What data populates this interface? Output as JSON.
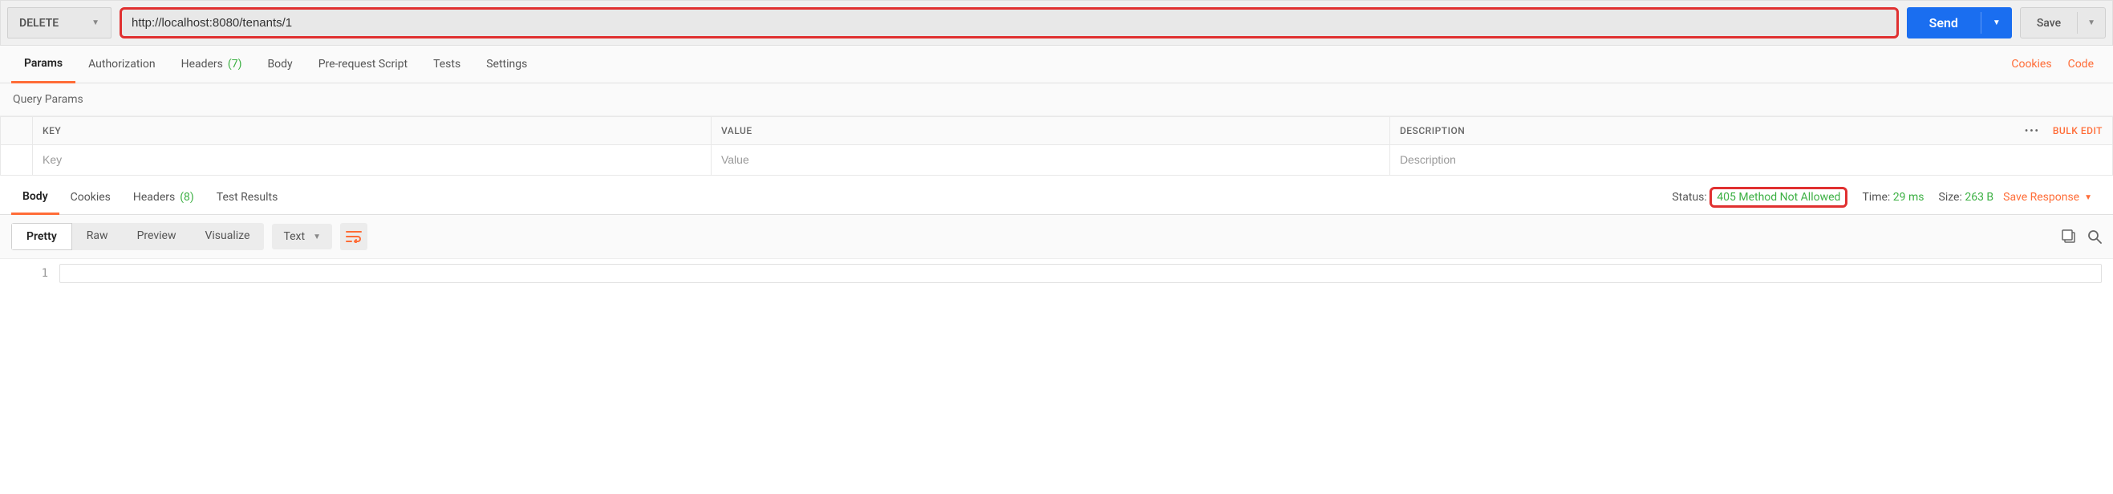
{
  "request": {
    "method": "DELETE",
    "url": "http://localhost:8080/tenants/1",
    "send_label": "Send",
    "save_label": "Save"
  },
  "req_tabs": {
    "params": "Params",
    "authorization": "Authorization",
    "headers": "Headers",
    "headers_count": "(7)",
    "body": "Body",
    "prerequest": "Pre-request Script",
    "tests": "Tests",
    "settings": "Settings",
    "cookies_link": "Cookies",
    "code_link": "Code"
  },
  "query_params": {
    "title": "Query Params",
    "cols": {
      "key": "KEY",
      "value": "VALUE",
      "desc": "DESCRIPTION"
    },
    "placeholders": {
      "key": "Key",
      "value": "Value",
      "desc": "Description"
    },
    "bulk_edit": "Bulk Edit"
  },
  "resp_tabs": {
    "body": "Body",
    "cookies": "Cookies",
    "headers": "Headers",
    "headers_count": "(8)",
    "tests": "Test Results"
  },
  "resp_meta": {
    "status_label": "Status:",
    "status_value": "405 Method Not Allowed",
    "time_label": "Time:",
    "time_value": "29 ms",
    "size_label": "Size:",
    "size_value": "263 B",
    "save_response": "Save Response"
  },
  "viewer": {
    "pretty": "Pretty",
    "raw": "Raw",
    "preview": "Preview",
    "visualize": "Visualize",
    "format": "Text"
  },
  "code": {
    "line1_num": "1"
  }
}
